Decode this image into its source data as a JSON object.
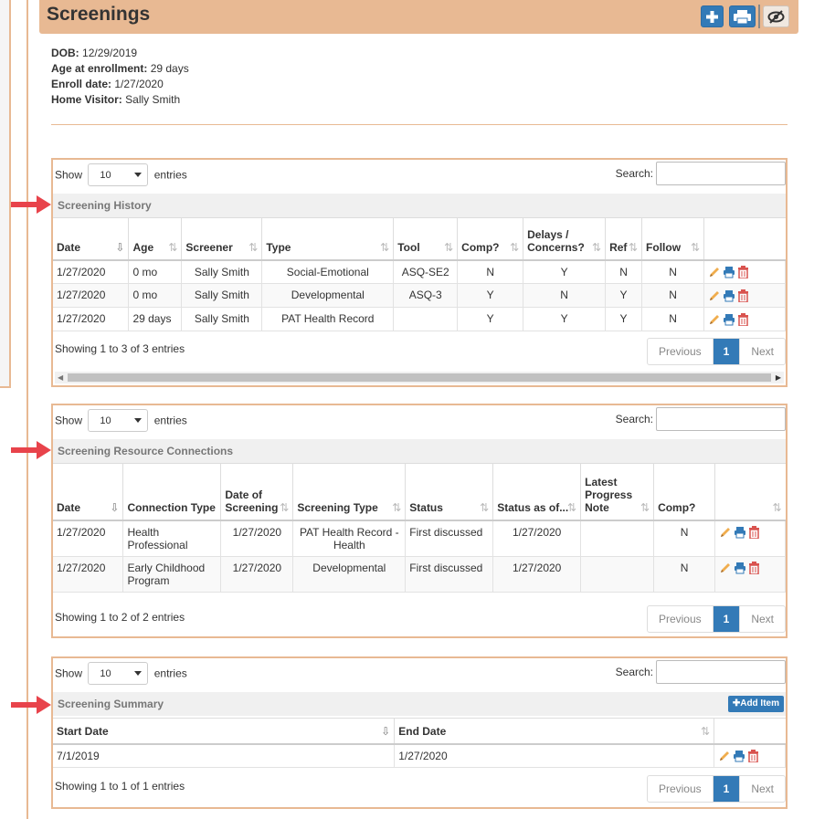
{
  "page": {
    "title": "Screenings",
    "header_buttons": [
      {
        "name": "add-button",
        "icon": "plus-icon"
      },
      {
        "name": "print-button",
        "icon": "printer-icon"
      },
      {
        "name": "hide-button",
        "icon": "eye-slash-icon"
      }
    ]
  },
  "child_info": {
    "dob_label": "DOB:",
    "dob_value": "12/29/2019",
    "age_label": "Age at enrollment:",
    "age_value": "29 days",
    "enroll_label": "Enroll date:",
    "enroll_value": "1/27/2020",
    "visitor_label": "Home Visitor:",
    "visitor_value": "Sally Smith"
  },
  "common": {
    "show_label": "Show",
    "entries_label": "entries",
    "page_length": "10",
    "search_label": "Search:",
    "previous": "Previous",
    "next": "Next",
    "current_page": "1",
    "add_item": "Add Item"
  },
  "colors": {
    "accent": "#e8b993",
    "primary": "#337ab7",
    "arrow": "#e8434b",
    "delete": "#d9534f",
    "edit": "#f0ad4e"
  },
  "history": {
    "title": "Screening History",
    "columns": [
      "Date",
      "Age",
      "Screener",
      "Type",
      "Tool",
      "Comp?",
      "Delays / Concerns?",
      "Ref",
      "Follow"
    ],
    "rows": [
      [
        "1/27/2020",
        "0 mo",
        "Sally Smith",
        "Social-Emotional",
        "ASQ-SE2",
        "N",
        "Y",
        "N",
        "N"
      ],
      [
        "1/27/2020",
        "0 mo",
        "Sally Smith",
        "Developmental",
        "ASQ-3",
        "Y",
        "N",
        "Y",
        "N"
      ],
      [
        "1/27/2020",
        "29 days",
        "Sally Smith",
        "PAT Health Record",
        "",
        "Y",
        "Y",
        "Y",
        "N"
      ]
    ],
    "info": "Showing 1 to 3 of 3 entries"
  },
  "resources": {
    "title": "Screening Resource Connections",
    "columns": [
      "Date",
      "Connection Type",
      "Date of Screening",
      "Screening Type",
      "Status",
      "Status as of...",
      "Latest Progress Note",
      "Comp?"
    ],
    "rows": [
      [
        "1/27/2020",
        "Health Professional",
        "1/27/2020",
        "PAT Health Record - Health",
        "First discussed",
        "1/27/2020",
        "",
        "N"
      ],
      [
        "1/27/2020",
        "Early Childhood Program",
        "1/27/2020",
        "Developmental",
        "First discussed",
        "1/27/2020",
        "",
        "N"
      ]
    ],
    "info": "Showing 1 to 2 of 2 entries"
  },
  "summary": {
    "title": "Screening Summary",
    "columns": [
      "Start Date",
      "End Date"
    ],
    "rows": [
      [
        "7/1/2019",
        "1/27/2020"
      ]
    ],
    "info": "Showing 1 to 1 of 1 entries"
  }
}
